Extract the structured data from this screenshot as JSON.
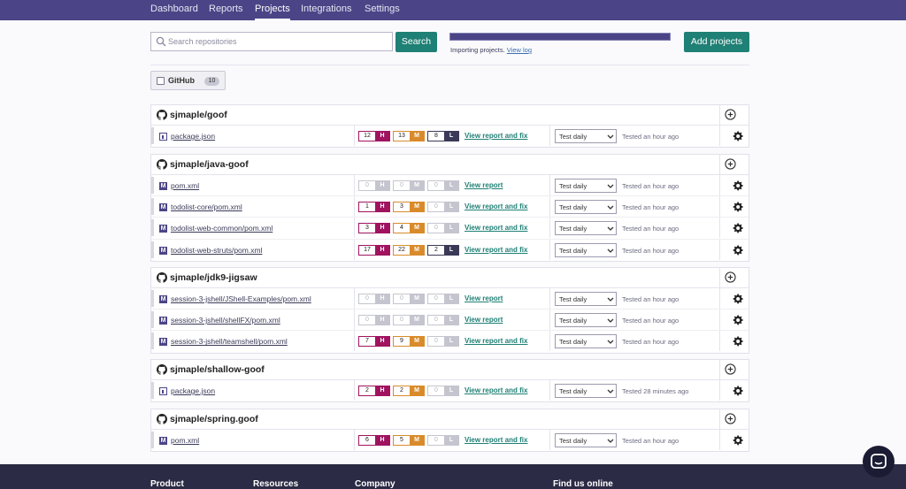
{
  "nav": {
    "items": [
      {
        "label": "Dashboard",
        "active": false
      },
      {
        "label": "Reports",
        "active": false
      },
      {
        "label": "Projects",
        "active": true
      },
      {
        "label": "Integrations",
        "active": false
      },
      {
        "label": "Settings",
        "active": false
      }
    ]
  },
  "search": {
    "placeholder": "Search repositories",
    "value": "",
    "button_label": "Search"
  },
  "import_status": {
    "text": "Importing projects.",
    "link_text": "View log",
    "progress": 1.0
  },
  "add_projects_label": "Add projects",
  "filter": {
    "label": "GitHub",
    "count": "10",
    "checked": false
  },
  "colors": {
    "accent": "#4b4587",
    "teal": "#1f8075",
    "high": "#a0135f",
    "medium": "#d98b2b",
    "low": "#3a3957",
    "empty": "#c5c5cf"
  },
  "groups": [
    {
      "name": "sjmaple/goof",
      "projects": [
        {
          "file": "package.json",
          "type": "npm",
          "h": "12",
          "m": "13",
          "l": "8",
          "action": "View report and fix",
          "frequency": "Test daily",
          "tested": "Tested an hour ago"
        }
      ]
    },
    {
      "name": "sjmaple/java-goof",
      "projects": [
        {
          "file": "pom.xml",
          "type": "maven",
          "h": "0",
          "m": "0",
          "l": "0",
          "action": "View report",
          "frequency": "Test daily",
          "tested": "Tested an hour ago"
        },
        {
          "file": "todolist-core/pom.xml",
          "type": "maven",
          "h": "1",
          "m": "3",
          "l": "0",
          "action": "View report and fix",
          "frequency": "Test daily",
          "tested": "Tested an hour ago"
        },
        {
          "file": "todolist-web-common/pom.xml",
          "type": "maven",
          "h": "3",
          "m": "4",
          "l": "0",
          "action": "View report and fix",
          "frequency": "Test daily",
          "tested": "Tested an hour ago"
        },
        {
          "file": "todolist-web-struts/pom.xml",
          "type": "maven",
          "h": "17",
          "m": "22",
          "l": "2",
          "action": "View report and fix",
          "frequency": "Test daily",
          "tested": "Tested an hour ago"
        }
      ]
    },
    {
      "name": "sjmaple/jdk9-jigsaw",
      "projects": [
        {
          "file": "session-3-jshell/JShell-Examples/pom.xml",
          "type": "maven",
          "h": "0",
          "m": "0",
          "l": "0",
          "action": "View report",
          "frequency": "Test daily",
          "tested": "Tested an hour ago"
        },
        {
          "file": "session-3-jshell/shellFX/pom.xml",
          "type": "maven",
          "h": "0",
          "m": "0",
          "l": "0",
          "action": "View report",
          "frequency": "Test daily",
          "tested": "Tested an hour ago"
        },
        {
          "file": "session-3-jshell/teamshell/pom.xml",
          "type": "maven",
          "h": "7",
          "m": "9",
          "l": "0",
          "action": "View report and fix",
          "frequency": "Test daily",
          "tested": "Tested an hour ago"
        }
      ]
    },
    {
      "name": "sjmaple/shallow-goof",
      "projects": [
        {
          "file": "package.json",
          "type": "npm",
          "h": "2",
          "m": "2",
          "l": "0",
          "action": "View report and fix",
          "frequency": "Test daily",
          "tested": "Tested 28 minutes ago"
        }
      ]
    },
    {
      "name": "sjmaple/spring.goof",
      "projects": [
        {
          "file": "pom.xml",
          "type": "maven",
          "h": "6",
          "m": "5",
          "l": "0",
          "action": "View report and fix",
          "frequency": "Test daily",
          "tested": "Tested an hour ago"
        }
      ]
    }
  ],
  "footer": {
    "headings": [
      "Product",
      "Resources",
      "Company",
      "Find us online"
    ]
  }
}
